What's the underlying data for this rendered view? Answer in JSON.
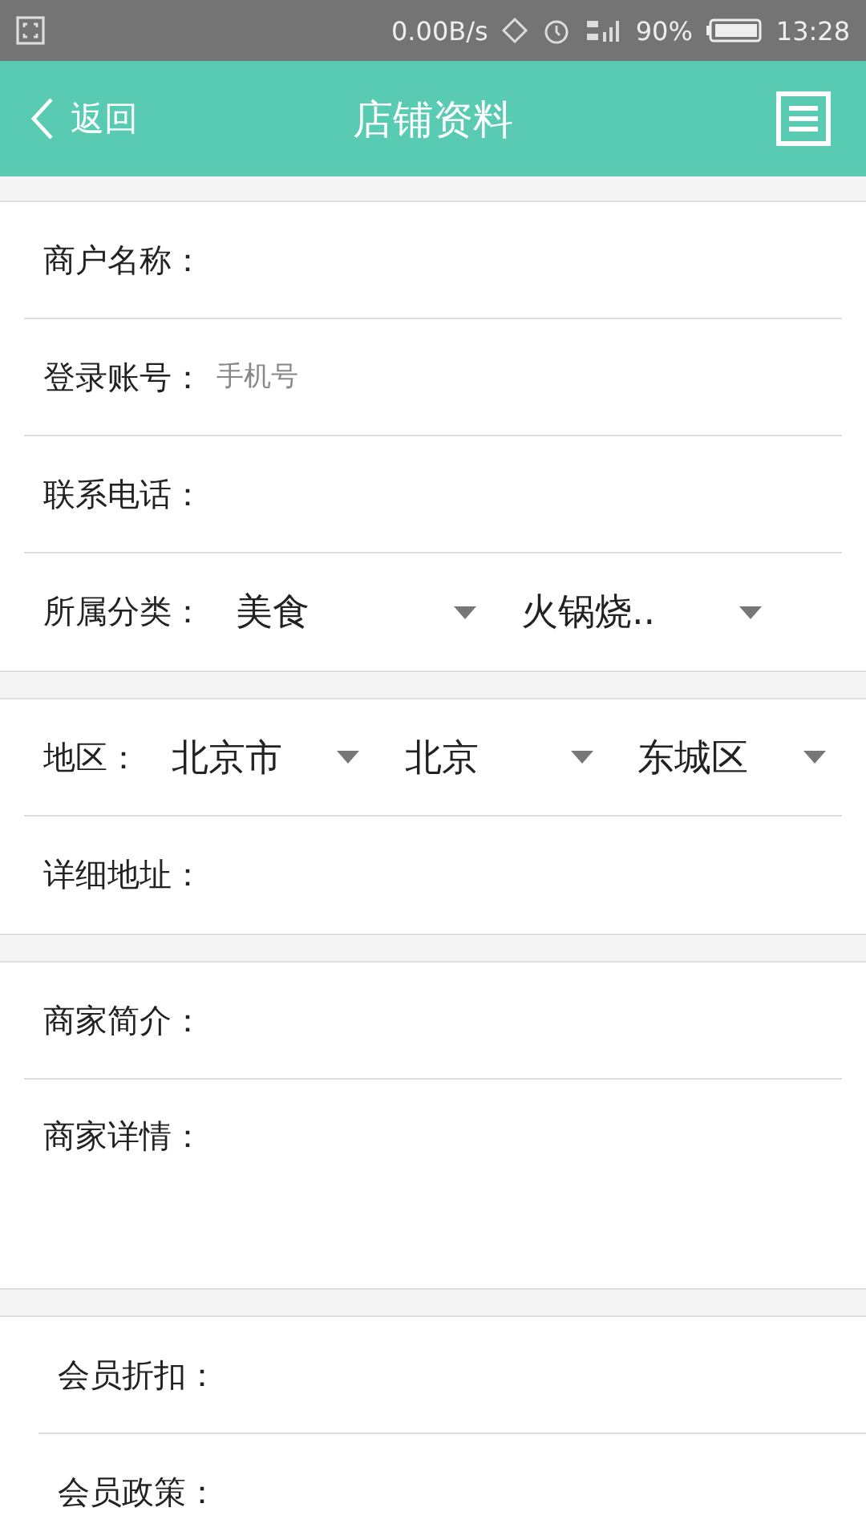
{
  "status_bar": {
    "speed": "0.00B/s",
    "battery": "90%",
    "time": "13:28"
  },
  "header": {
    "back": "返回",
    "title": "店铺资料"
  },
  "sections": [
    {
      "inset": false,
      "rows": [
        {
          "kind": "field",
          "label": "商户名称："
        },
        {
          "kind": "field",
          "label": "登录账号：",
          "placeholder": "手机号"
        },
        {
          "kind": "field",
          "label": "联系电话："
        },
        {
          "kind": "select",
          "label": "所属分类：",
          "selects": [
            "美食",
            "火锅烧.."
          ]
        }
      ]
    },
    {
      "inset": false,
      "rows": [
        {
          "kind": "select",
          "label": "地区：",
          "selects": [
            "北京市",
            "北京",
            "东城区"
          ]
        },
        {
          "kind": "field",
          "label": "详细地址："
        }
      ]
    },
    {
      "inset": false,
      "rows": [
        {
          "kind": "field",
          "label": "商家简介："
        },
        {
          "kind": "area",
          "label": "商家详情："
        }
      ]
    },
    {
      "inset": true,
      "rows": [
        {
          "kind": "field",
          "label": "会员折扣："
        },
        {
          "kind": "field",
          "label": "会员政策："
        }
      ]
    }
  ]
}
